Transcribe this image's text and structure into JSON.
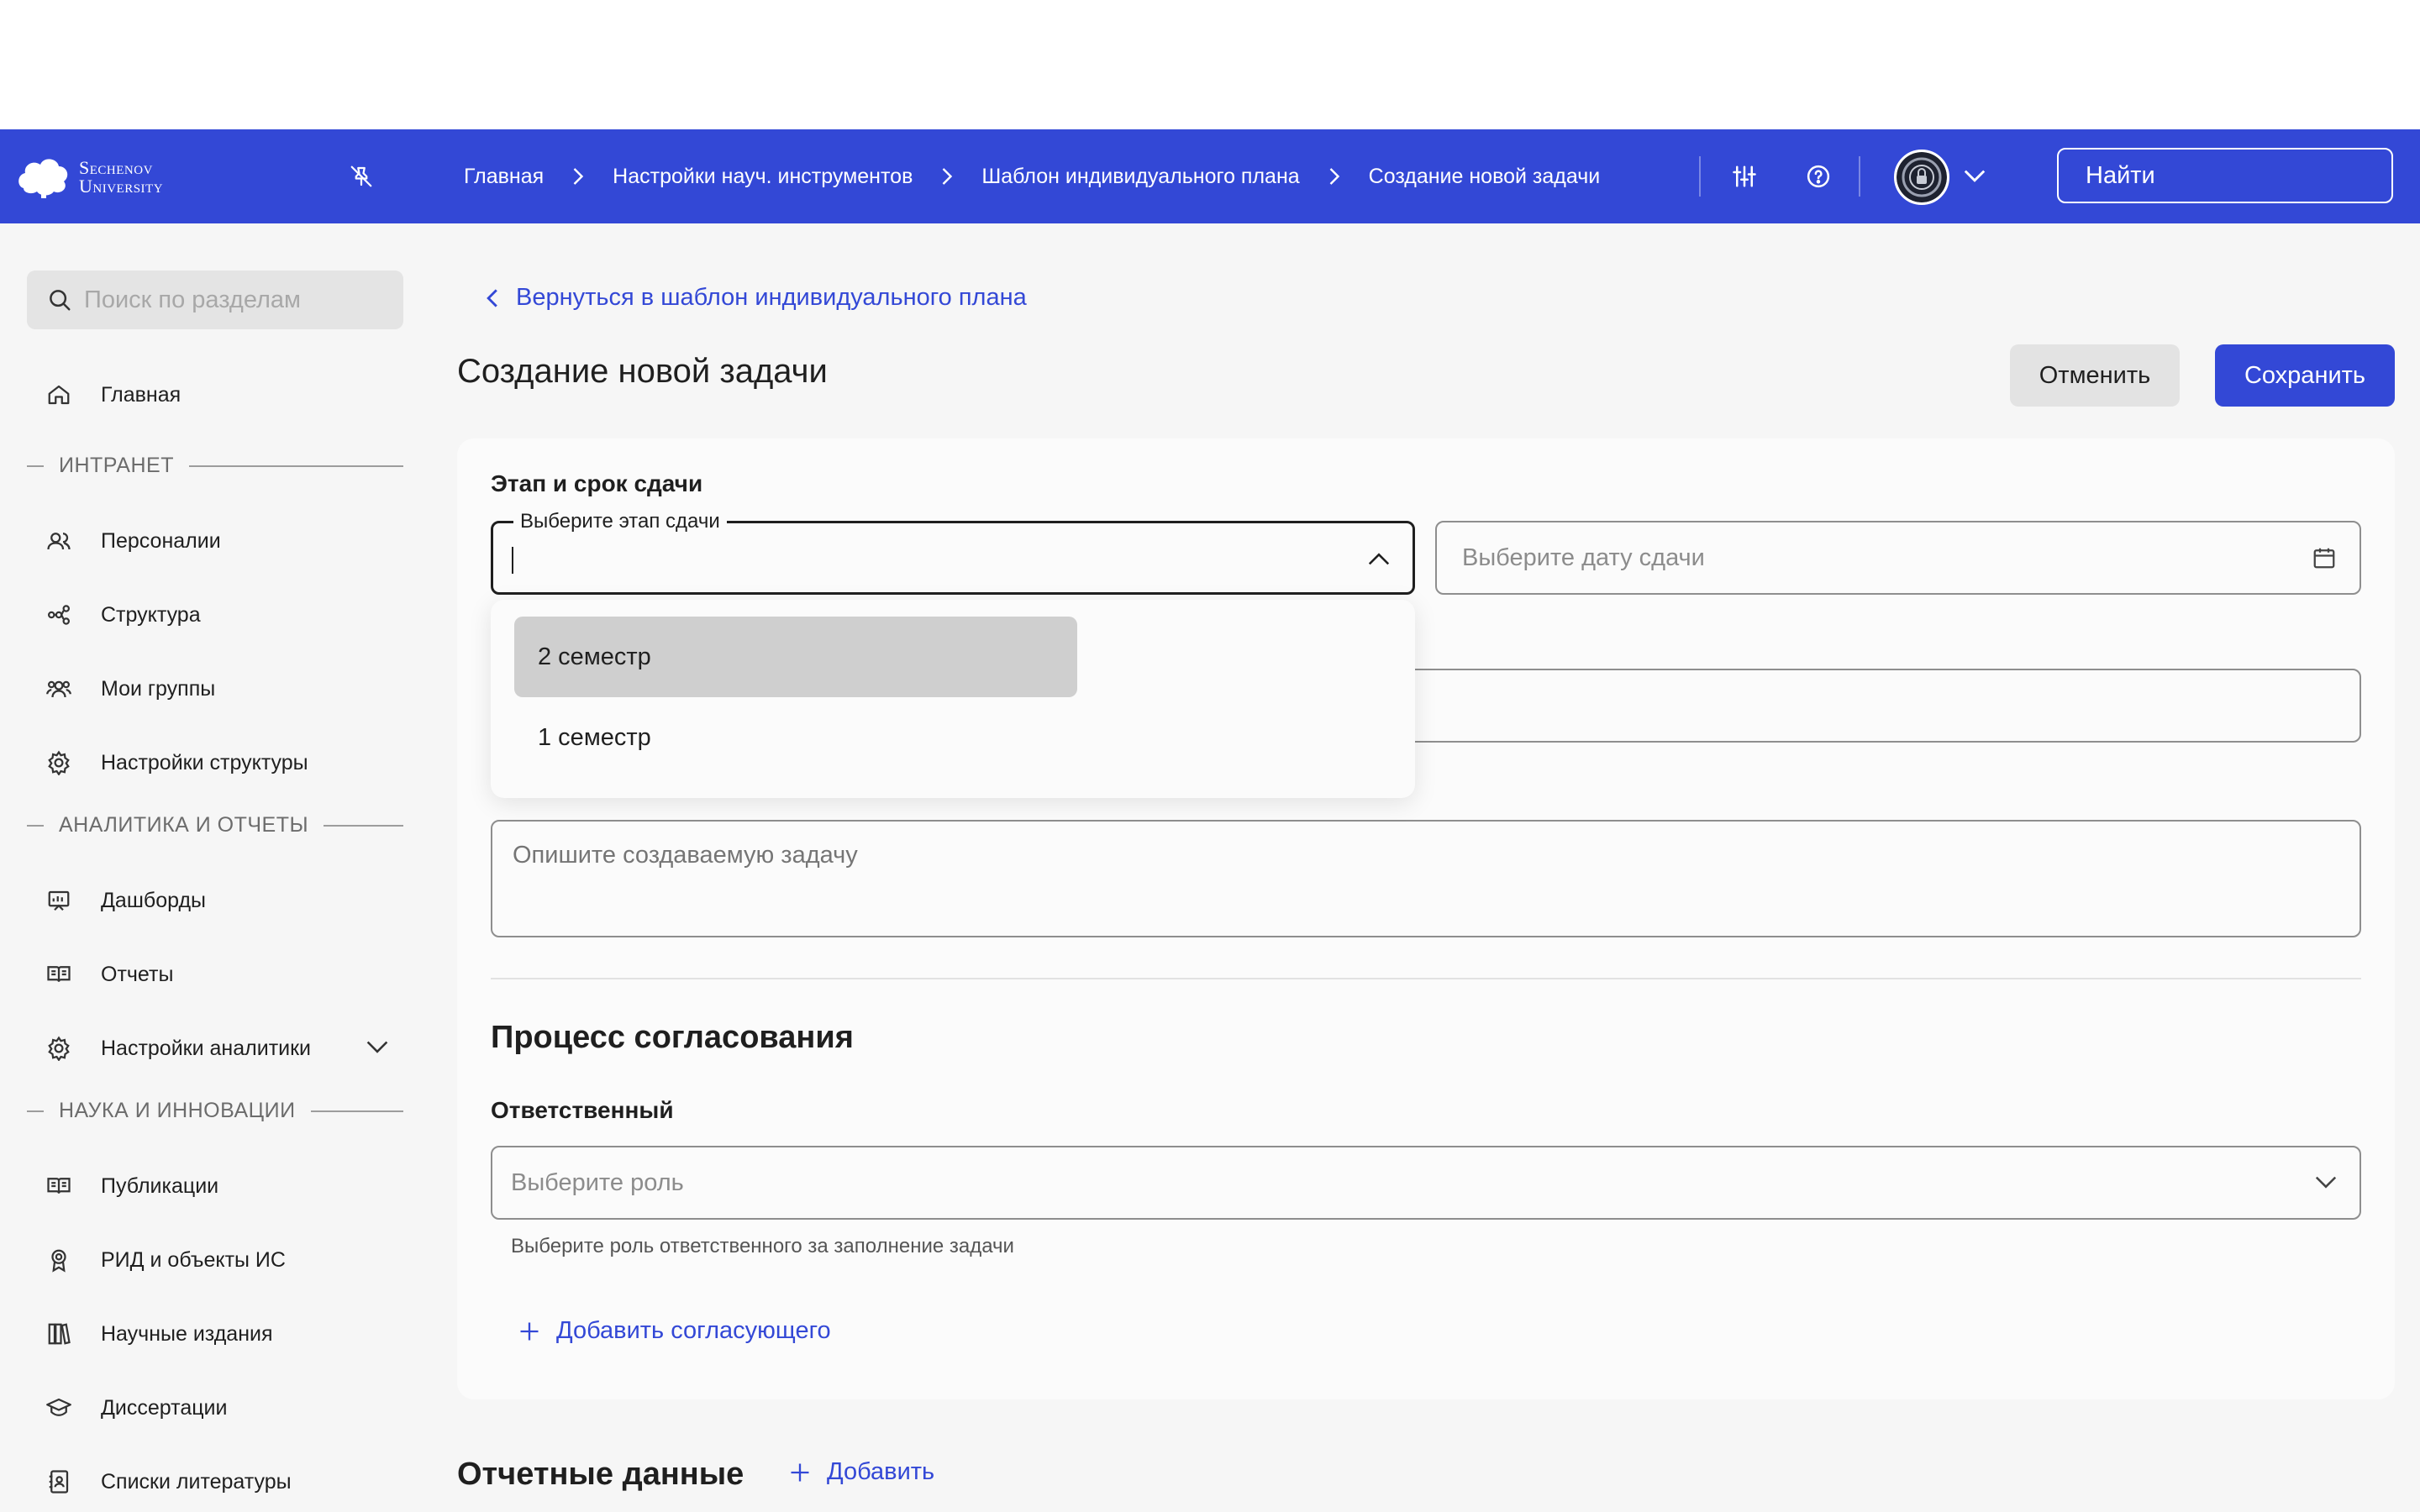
{
  "app": {
    "logo_line1": "Sechenov",
    "logo_line2": "University"
  },
  "breadcrumb": [
    "Главная",
    "Настройки науч. инструментов",
    "Шаблон индивидуального плана",
    "Создание новой задачи"
  ],
  "topbar": {
    "search_placeholder": "Найти"
  },
  "sidebar": {
    "search_placeholder": "Поиск по разделам",
    "home": "Главная",
    "sections": [
      {
        "title": "ИНТРАНЕТ",
        "items": [
          "Персоналии",
          "Структура",
          "Мои группы",
          "Настройки структуры"
        ]
      },
      {
        "title": "АНАЛИТИКА И ОТЧЕТЫ",
        "items": [
          "Дашборды",
          "Отчеты",
          "Настройки аналитики"
        ]
      },
      {
        "title": "НАУКА И ИННОВАЦИИ",
        "items": [
          "Публикации",
          "РИД и объекты ИС",
          "Научные издания",
          "Диссертации",
          "Списки литературы"
        ]
      }
    ]
  },
  "main": {
    "back_link": "Вернуться в шаблон индивидуального плана",
    "title": "Создание новой задачи",
    "cancel_label": "Отменить",
    "save_label": "Сохранить",
    "stage_section_label": "Этап и срок сдачи",
    "stage_select_label": "Выберите этап сдачи",
    "stage_value": "",
    "date_placeholder": "Выберите дату сдачи",
    "description_placeholder": "Опишите создаваемую задачу",
    "dropdown_options": [
      "2 семестр",
      "1 семестр"
    ],
    "approval_title": "Процесс согласования",
    "responsible_label": "Ответственный",
    "role_placeholder": "Выберите роль",
    "role_hint": "Выберите роль ответственного за заполнение задачи",
    "add_approver": "Добавить согласующего",
    "report_title": "Отчетные данные",
    "report_add": "Добавить"
  },
  "colors": {
    "accent": "#3348d6",
    "background": "#f6f6f6",
    "card": "#fbfbfb"
  }
}
